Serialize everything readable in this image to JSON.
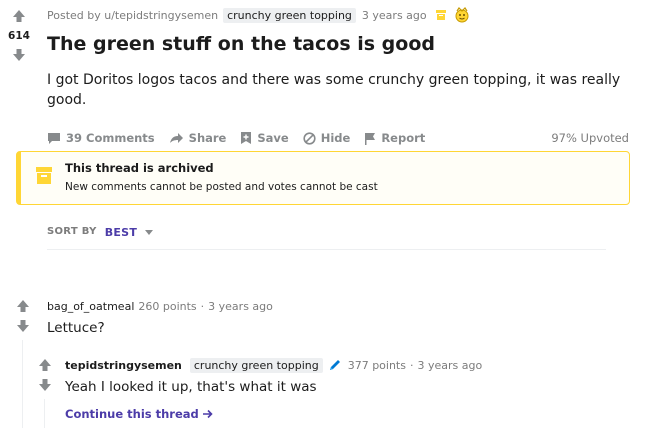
{
  "post": {
    "score": "614",
    "posted_by": "Posted by u/tepidstringysemen",
    "flair": "crunchy green topping",
    "age": "3 years ago",
    "title": "The green stuff on the tacos is good",
    "body": "I got Doritos logos tacos and there was some crunchy green topping, it was really good.",
    "actions": {
      "comments": "39 Comments",
      "share": "Share",
      "save": "Save",
      "hide": "Hide",
      "report": "Report"
    },
    "upvoted": "97% Upvoted"
  },
  "archived": {
    "title": "This thread is archived",
    "text": "New comments cannot be posted and votes cannot be cast"
  },
  "sort": {
    "label": "SORT BY",
    "value": "BEST"
  },
  "comments": [
    {
      "author": "bag_of_oatmeal",
      "points": "260 points",
      "separator": "·",
      "age": "3 years ago",
      "body": "Lettuce?"
    },
    {
      "author": "tepidstringysemen",
      "flair": "crunchy green topping",
      "points": "377 points",
      "separator": "·",
      "age": "3 years ago",
      "body": "Yeah I looked it up, that's what it was",
      "continue": "Continue this thread"
    }
  ],
  "colors": {
    "accent": "#4c3ca8",
    "archived_border": "#ffd635",
    "icon_gray": "#878a8c"
  },
  "icons": {
    "upvote": "arrow-up-icon",
    "downvote": "arrow-down-icon",
    "archived": "archive-box-icon",
    "award": "award-icon",
    "mod": "pencil-icon"
  }
}
